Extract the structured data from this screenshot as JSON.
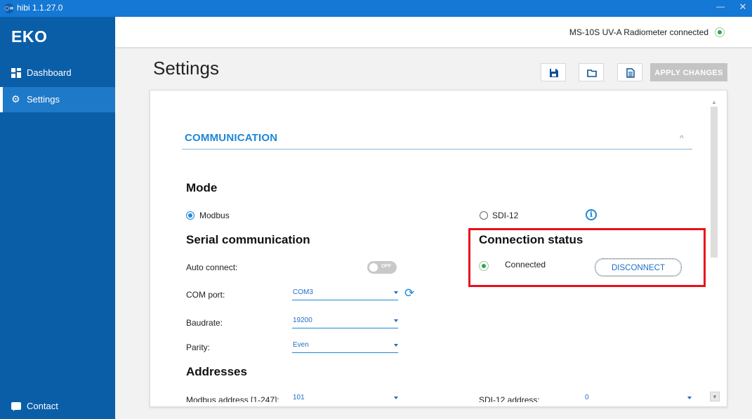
{
  "window": {
    "app_icon_text": "○≡",
    "title": "hibi 1.1.27.0",
    "minimize": "—",
    "close": "✕"
  },
  "sidebar": {
    "logo": "EKO",
    "items": [
      {
        "label": "Dashboard",
        "icon": "dashboard-icon"
      },
      {
        "label": "Settings",
        "icon": "gear-icon",
        "active": true
      },
      {
        "label": "Contact",
        "icon": "chat-icon"
      }
    ]
  },
  "header": {
    "connection_text": "MS-10S UV-A Radiometer connected",
    "status": "connected"
  },
  "page": {
    "title": "Settings"
  },
  "toolbar": {
    "buttons": [
      {
        "icon": "save-icon"
      },
      {
        "icon": "folder-icon"
      },
      {
        "icon": "document-icon"
      }
    ],
    "apply_label": "APPLY CHANGES"
  },
  "communication": {
    "section_title": "COMMUNICATION",
    "collapse_glyph": "^",
    "mode": {
      "heading": "Mode",
      "options": [
        {
          "label": "Modbus",
          "selected": true
        },
        {
          "label": "SDI-12",
          "selected": false
        }
      ],
      "info_glyph": "i"
    },
    "serial": {
      "heading": "Serial communication",
      "auto_connect_label": "Auto connect:",
      "auto_connect_state": "OFF",
      "com_port_label": "COM port:",
      "com_port_value": "COM3",
      "refresh_glyph": "⟳",
      "baudrate_label": "Baudrate:",
      "baudrate_value": "19200",
      "parity_label": "Parity:",
      "parity_value": "Even"
    },
    "connection_status": {
      "heading": "Connection status",
      "state_label": "Connected",
      "disconnect_label": "DISCONNECT"
    },
    "addresses": {
      "heading": "Addresses",
      "modbus_label": "Modbus address [1-247]:",
      "modbus_value": "101",
      "sdi_label": "SDI-12 address:",
      "sdi_value": "0"
    }
  },
  "colors": {
    "accent": "#1e88d6",
    "sidebar": "#0a5ea8",
    "titlebar": "#1478d4",
    "highlight": "#e8101c",
    "status_ok": "#2fa84f"
  }
}
